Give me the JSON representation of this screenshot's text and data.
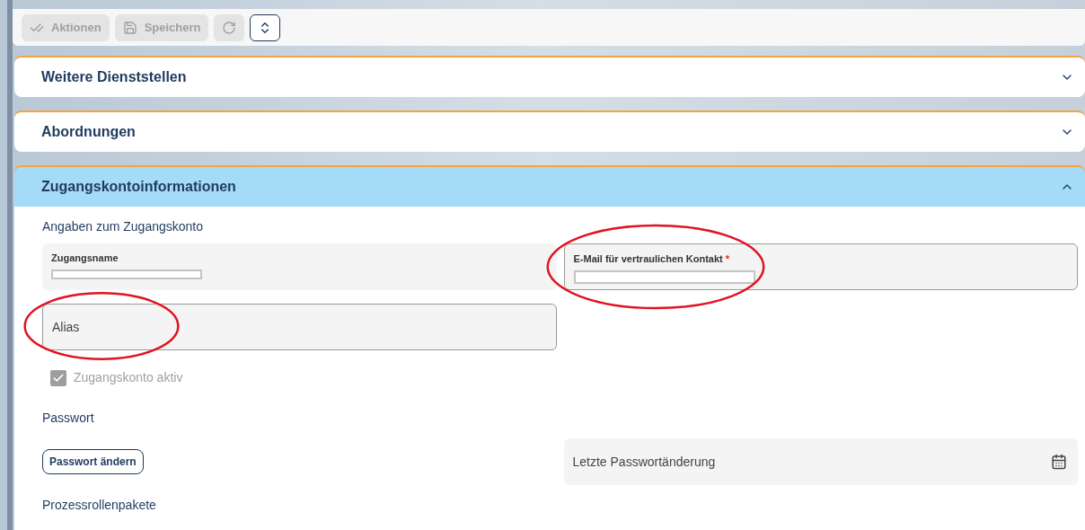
{
  "toolbar": {
    "buttons": [
      {
        "kind": "actions",
        "label": "Aktionen",
        "disabled": true
      },
      {
        "kind": "save",
        "label": "Speichern",
        "disabled": true
      },
      {
        "kind": "reset",
        "disabled": true
      },
      {
        "kind": "expand",
        "disabled": false
      }
    ]
  },
  "sections": [
    {
      "title": "Weitere Dienststellen",
      "expanded": false
    },
    {
      "title": "Abordnungen",
      "expanded": false
    },
    {
      "title": "Zugangskontoinformationen",
      "expanded": true
    }
  ],
  "account": {
    "heading": "Angaben zum Zugangskonto",
    "username": {
      "label": "Zugangsname"
    },
    "email": {
      "label": "E-Mail für vertraulichen Kontakt",
      "required_mark": "*"
    },
    "alias": {
      "placeholder": "Alias"
    },
    "active": {
      "label": "Zugangskonto aktiv",
      "checked": true,
      "disabled": true
    },
    "password_heading": "Passwort",
    "change_password": "Passwort ändern",
    "last_change": {
      "placeholder": "Letzte Passwortänderung"
    },
    "roles_heading": "Prozessrollenpakete"
  }
}
